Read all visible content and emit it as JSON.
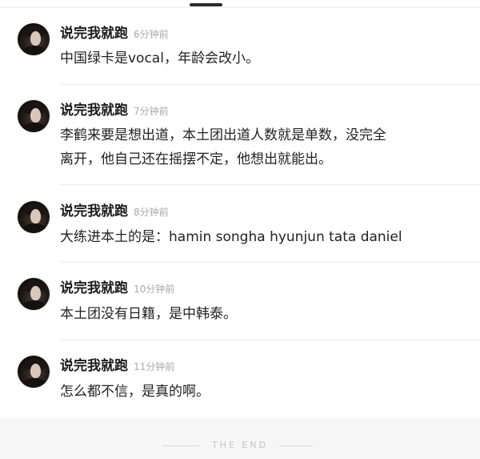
{
  "comments": [
    {
      "username": "说完我就跑",
      "time": "6分钟前",
      "lines": [
        "中国绿卡是vocal，年龄会改小。"
      ]
    },
    {
      "username": "说完我就跑",
      "time": "7分钟前",
      "lines": [
        "李鹤来要是想出道，本土团出道人数就是单数，没完全",
        "离开，他自己还在摇摆不定，他想出就能出。"
      ]
    },
    {
      "username": "说完我就跑",
      "time": "8分钟前",
      "lines": [
        "大练进本土的是：hamin songha hyunjun tata daniel"
      ]
    },
    {
      "username": "说完我就跑",
      "time": "10分钟前",
      "lines": [
        "本土团没有日籍，是中韩泰。"
      ]
    },
    {
      "username": "说完我就跑",
      "time": "11分钟前",
      "lines": [
        "怎么都不信，是真的啊。"
      ]
    }
  ],
  "footer": {
    "text": "THE END"
  },
  "colors": {
    "username": "#1b1b1b",
    "timestamp": "#a9a9a9",
    "body": "#222222",
    "divider": "#ececec",
    "footer_bg": "#f6f6f6"
  }
}
